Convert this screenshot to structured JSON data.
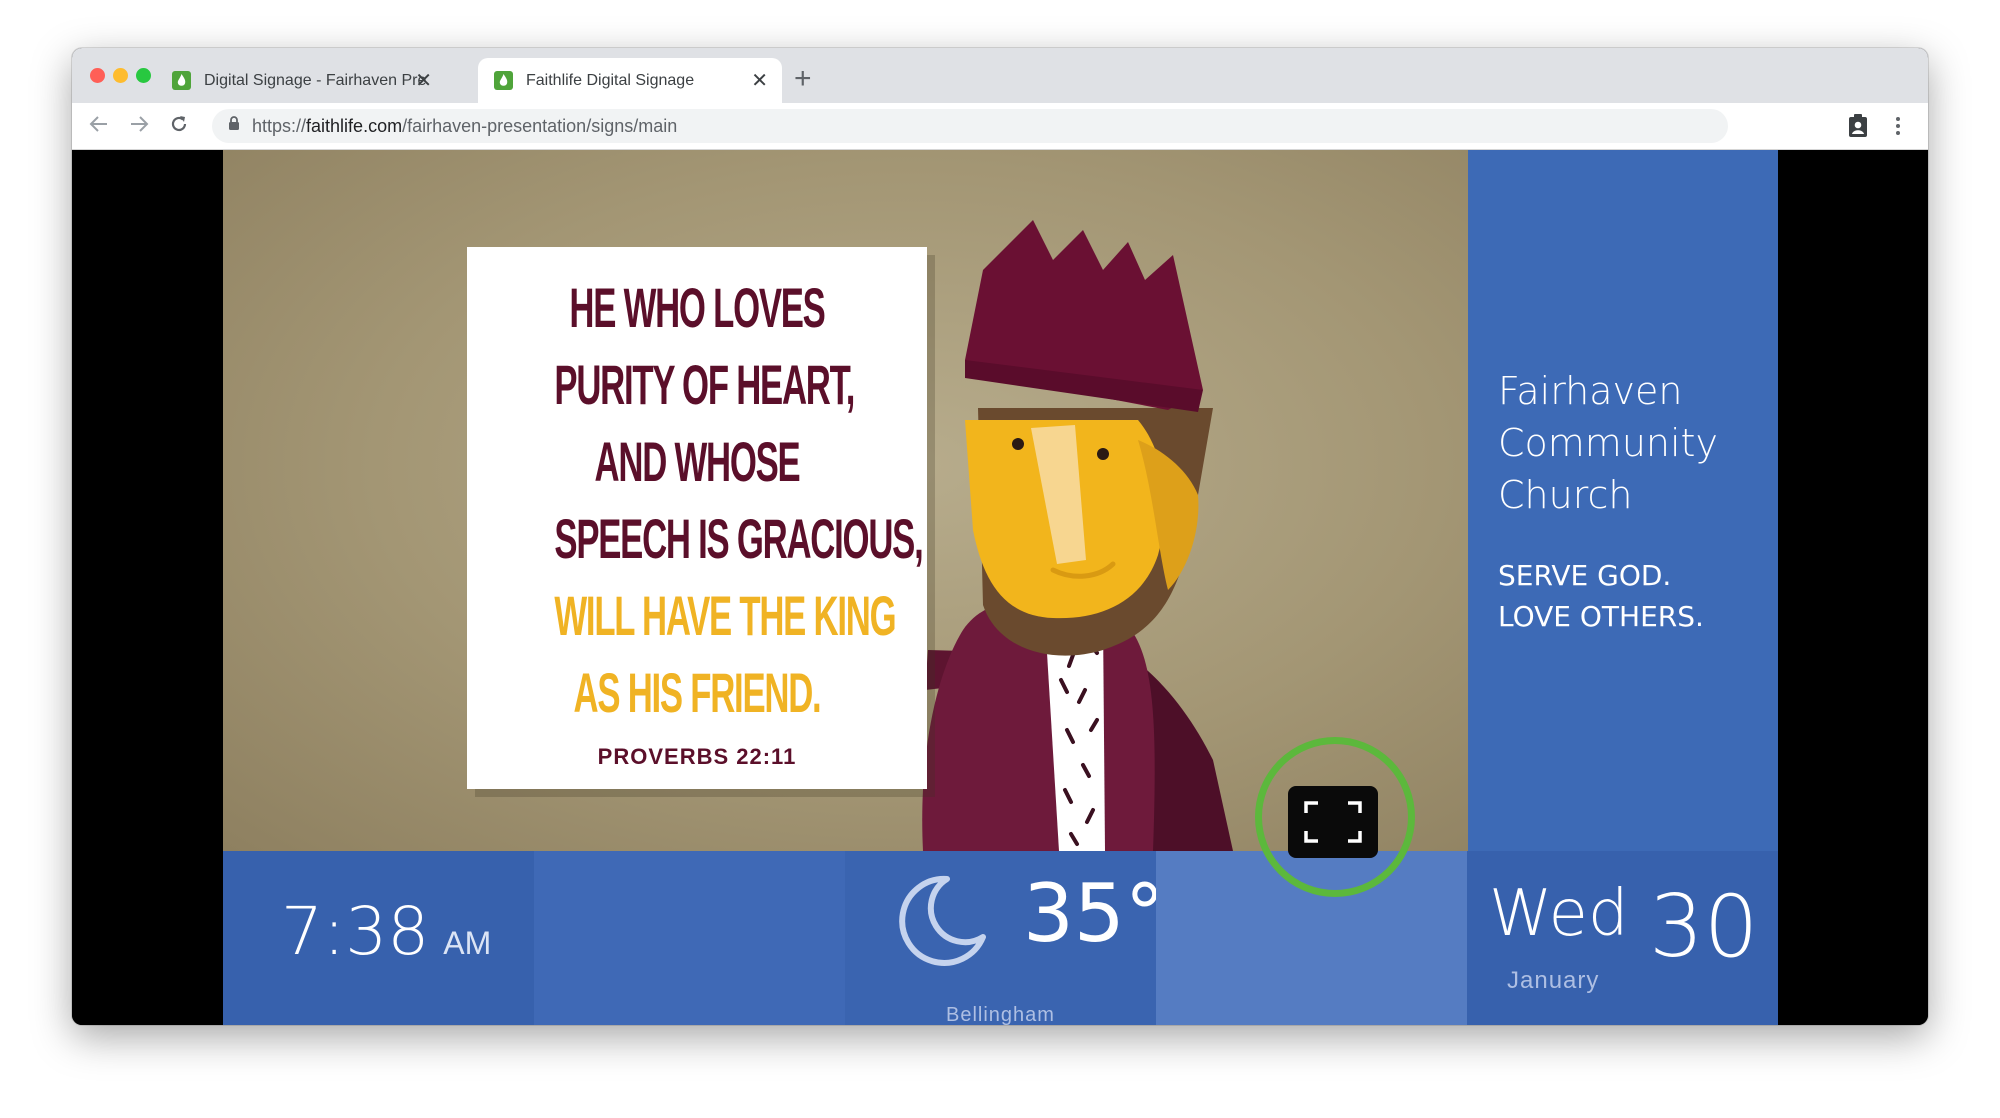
{
  "browser": {
    "tabs": [
      {
        "title": "Digital Signage - Fairhaven Pre",
        "active": false
      },
      {
        "title": "Faithlife Digital Signage",
        "active": true
      }
    ],
    "url_prefix": "https://",
    "url_domain": "faithlife.com",
    "url_path": "/fairhaven-presentation/signs/main"
  },
  "slide": {
    "verse_lines_dark": [
      "HE WHO LOVES",
      "PURITY OF HEART,",
      "AND WHOSE",
      "SPEECH IS GRACIOUS,"
    ],
    "verse_lines_gold": [
      "WILL HAVE THE KING",
      "AS HIS FRIEND."
    ],
    "reference": "PROVERBS 22:11"
  },
  "sidebar": {
    "church_lines": [
      "Fairhaven",
      "Community",
      "Church"
    ],
    "motto_lines": [
      "SERVE GOD.",
      "LOVE OTHERS."
    ]
  },
  "bottom_bar": {
    "time": "7:38",
    "ampm": "AM",
    "weather_icon": "moon-icon",
    "temperature": "35°",
    "city": "Bellingham",
    "day": "Wed",
    "month": "January",
    "date": "30"
  },
  "colors": {
    "sidebar_blue": "#3d6ab6",
    "verse_dark": "#5b0f2a",
    "verse_gold": "#f0b324",
    "highlight_green": "#5cb83c"
  }
}
